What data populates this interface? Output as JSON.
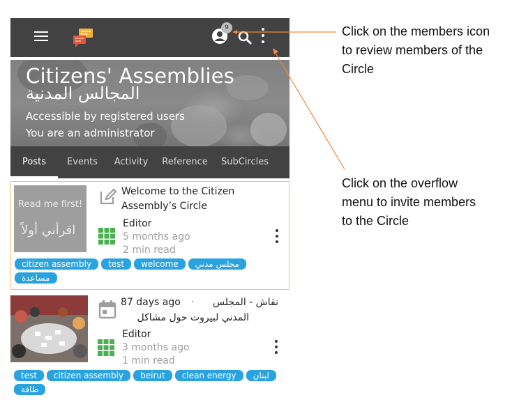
{
  "header": {
    "members_count": "9",
    "icons": [
      "menu-icon",
      "app-logo-icon",
      "members-icon",
      "search-icon",
      "more-vert-icon"
    ]
  },
  "hero": {
    "title": "Citizens' Assemblies",
    "title_ar": "المجالس المدنية",
    "access": "Accessible by registered users",
    "role": "You are an administrator"
  },
  "tabs": [
    {
      "label": "Posts",
      "active": true
    },
    {
      "label": "Events",
      "active": false
    },
    {
      "label": "Activity",
      "active": false
    },
    {
      "label": "Reference",
      "active": false
    },
    {
      "label": "SubCircles",
      "active": false
    }
  ],
  "posts": [
    {
      "thumb_line1": "Read me first!",
      "thumb_line2": "اقرأني أولاً",
      "title_line1": "Welcome to the Citizen",
      "title_line2": "Assembly’s Circle",
      "author": "Editor",
      "age": "5 months ago",
      "read_time": "2 min read",
      "tags": [
        "citizen assembly",
        "test",
        "welcome",
        "مجلس مدني",
        "مساعدة"
      ]
    },
    {
      "date": "87 days ago",
      "separator": "·",
      "title_ar_line1": "نقاش - المجلس",
      "title_ar_line2": "المدني لبيروت حول مشاكل",
      "author": "Editor",
      "age": "3 months ago",
      "read_time": "1 min read",
      "tags": [
        "test",
        "citizen assembly",
        "beirut",
        "clean energy",
        "لبنان",
        "طاقة"
      ]
    }
  ],
  "annotations": {
    "members": [
      "Click on the members icon",
      "to review members of the",
      "Circle"
    ],
    "overflow": [
      "Click on the overflow",
      "menu to invite members",
      "to the Circle"
    ],
    "arrow_color": "#f0883e"
  },
  "colors": {
    "bar": "#424242",
    "tag": "#29a3e0",
    "highlight_border": "#f1c27a",
    "avatar_green": "#4caf50"
  }
}
